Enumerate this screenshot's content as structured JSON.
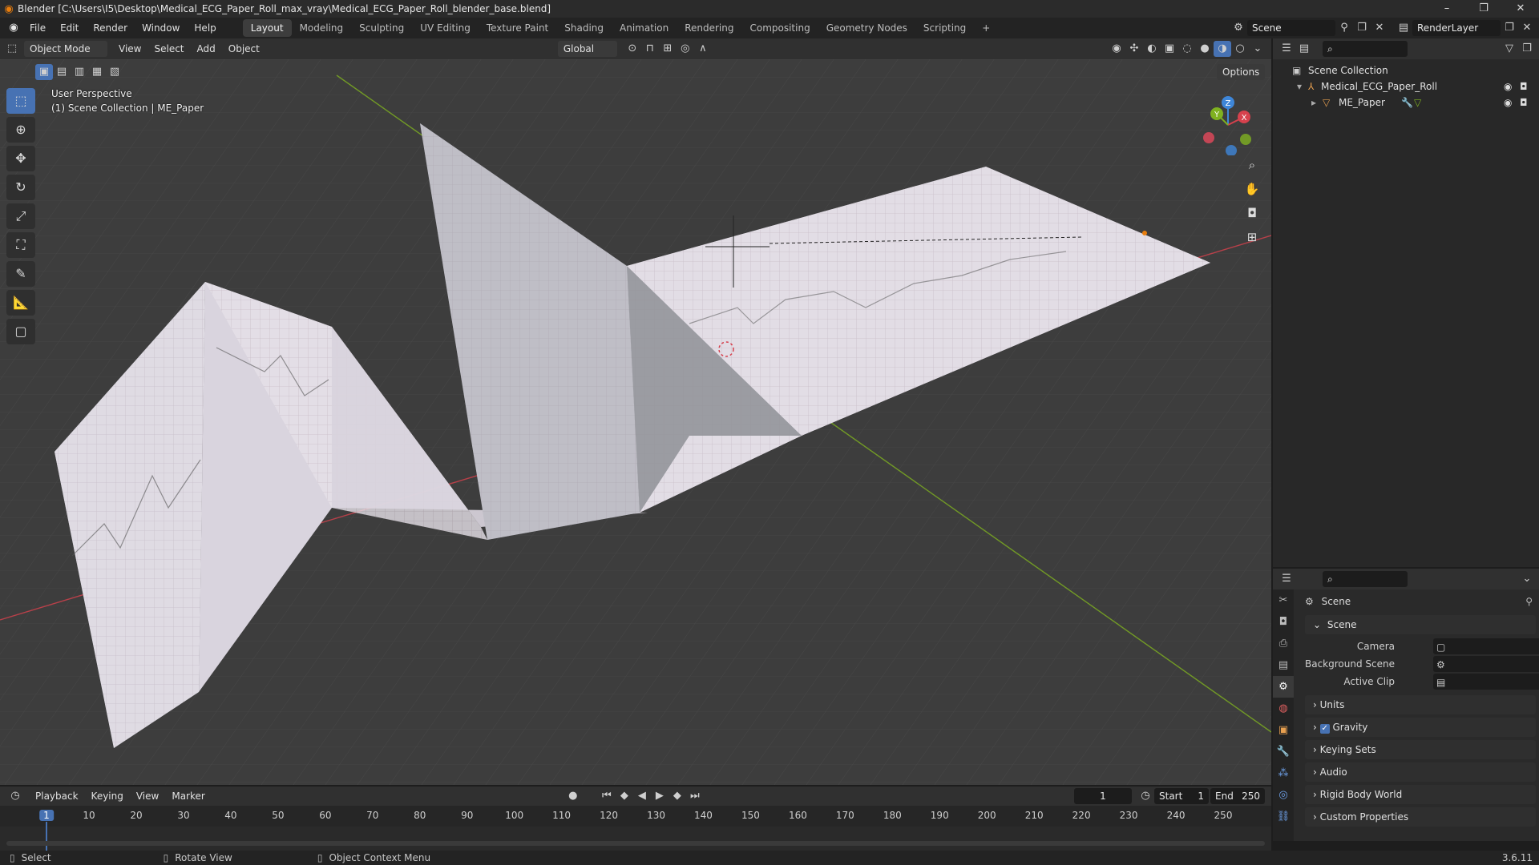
{
  "window": {
    "title": "Blender [C:\\Users\\I5\\Desktop\\Medical_ECG_Paper_Roll_max_vray\\Medical_ECG_Paper_Roll_blender_base.blend]",
    "minimize": "–",
    "maximize": "❐",
    "close": "✕"
  },
  "menus": [
    "File",
    "Edit",
    "Render",
    "Window",
    "Help"
  ],
  "workspaces": [
    "Layout",
    "Modeling",
    "Sculpting",
    "UV Editing",
    "Texture Paint",
    "Shading",
    "Animation",
    "Rendering",
    "Compositing",
    "Geometry Nodes",
    "Scripting"
  ],
  "add_workspace": "+",
  "scene_field": "Scene",
  "view_layer_field": "RenderLayer",
  "viewport_header": {
    "mode": "Object Mode",
    "menus": [
      "View",
      "Select",
      "Add",
      "Object"
    ],
    "orientation": "Global",
    "options": "Options"
  },
  "viewport": {
    "perspective": "User Perspective",
    "collection_info": "(1) Scene Collection | ME_Paper",
    "gizmo": {
      "x": "X",
      "y": "Y",
      "z": "Z"
    }
  },
  "outliner": {
    "root": "Scene Collection",
    "items": [
      {
        "name": "Medical_ECG_Paper_Roll"
      },
      {
        "name": "ME_Paper"
      }
    ]
  },
  "properties": {
    "context": "Scene",
    "panel_scene": "Scene",
    "fields": [
      {
        "label": "Camera"
      },
      {
        "label": "Background Scene"
      },
      {
        "label": "Active Clip"
      }
    ],
    "panels": [
      "Units",
      "Gravity",
      "Keying Sets",
      "Audio",
      "Rigid Body World",
      "Custom Properties"
    ],
    "gravity_checked": true
  },
  "timeline": {
    "menus": [
      "Playback",
      "Keying",
      "View",
      "Marker"
    ],
    "current_frame": "1",
    "start_label": "Start",
    "start": "1",
    "end_label": "End",
    "end": "250",
    "ticks": [
      "1",
      "10",
      "20",
      "30",
      "40",
      "50",
      "60",
      "70",
      "80",
      "90",
      "100",
      "110",
      "120",
      "130",
      "140",
      "150",
      "160",
      "170",
      "180",
      "190",
      "200",
      "210",
      "220",
      "230",
      "240",
      "250"
    ]
  },
  "statusbar": {
    "select": "Select",
    "rotate": "Rotate View",
    "context_menu": "Object Context Menu",
    "version": "3.6.11"
  },
  "colors": {
    "accent": "#4772b3",
    "axis_x": "#d6414d",
    "axis_y": "#7fb120",
    "axis_z": "#3e86d8",
    "playhead": "#4772b3"
  }
}
